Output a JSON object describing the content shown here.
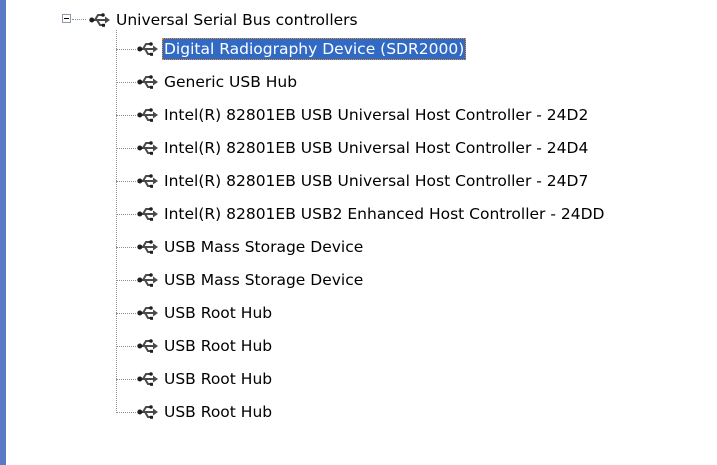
{
  "tree": {
    "root": {
      "label": "Universal Serial Bus controllers",
      "icon": "usb-icon",
      "expanded": true
    },
    "items": [
      {
        "label": "Digital Radiography Device (SDR2000)",
        "icon": "usb-icon",
        "selected": true
      },
      {
        "label": "Generic USB Hub",
        "icon": "usb-icon"
      },
      {
        "label": "Intel(R) 82801EB USB Universal Host Controller - 24D2",
        "icon": "usb-icon"
      },
      {
        "label": "Intel(R) 82801EB USB Universal Host Controller - 24D4",
        "icon": "usb-icon"
      },
      {
        "label": "Intel(R) 82801EB USB Universal Host Controller - 24D7",
        "icon": "usb-icon"
      },
      {
        "label": "Intel(R) 82801EB USB2 Enhanced Host Controller - 24DD",
        "icon": "usb-icon"
      },
      {
        "label": "USB Mass Storage Device",
        "icon": "usb-icon"
      },
      {
        "label": "USB Mass Storage Device",
        "icon": "usb-icon"
      },
      {
        "label": "USB Root Hub",
        "icon": "usb-icon"
      },
      {
        "label": "USB Root Hub",
        "icon": "usb-icon"
      },
      {
        "label": "USB Root Hub",
        "icon": "usb-icon"
      },
      {
        "label": "USB Root Hub",
        "icon": "usb-icon"
      }
    ]
  },
  "colors": {
    "selection": "#316ac5",
    "selection_text": "#ffffff",
    "window_edge": "#5a79c7"
  }
}
